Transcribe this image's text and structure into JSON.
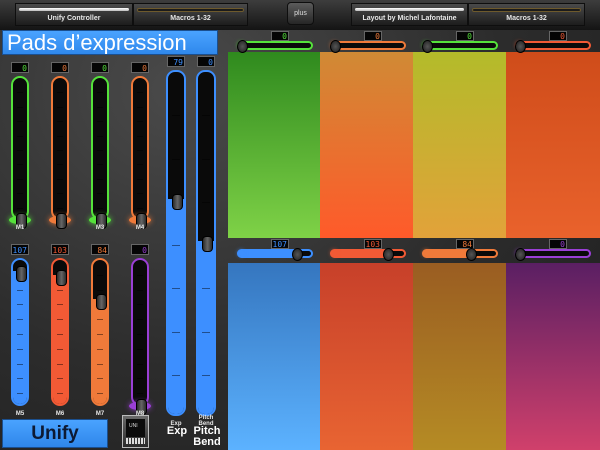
{
  "tabs": [
    {
      "label": "Unify Controller",
      "active": true
    },
    {
      "label": "Macros 1-32",
      "active": false
    },
    {
      "label": "Layout by Michel Lafontaine",
      "active": true
    },
    {
      "label": "Macros 1-32",
      "active": false
    }
  ],
  "plus_label": "plus",
  "title": "Pads d’expression",
  "top_row_faders": [
    {
      "label": "M1",
      "value": "0",
      "color": "#55e23b"
    },
    {
      "label": "",
      "value": "0",
      "color": "#f07a3a"
    },
    {
      "label": "M3",
      "value": "0",
      "color": "#55e23b"
    },
    {
      "label": "M4",
      "value": "0",
      "color": "#f07a3a"
    }
  ],
  "bottom_row_faders": [
    {
      "label": "M5",
      "value": "107",
      "color": "#3d8fff"
    },
    {
      "label": "M6",
      "value": "103",
      "color": "#f25a35"
    },
    {
      "label": "M7",
      "value": "84",
      "color": "#f07a3a"
    },
    {
      "label": "M8",
      "value": "0",
      "color": "#9a3fd6"
    }
  ],
  "expression": {
    "label": "Exp",
    "value": "79"
  },
  "pitch_bend": {
    "label": "Pitch Bend",
    "value": "0"
  },
  "pad_faders_top": [
    {
      "value": "0",
      "color": "#55e23b"
    },
    {
      "value": "0",
      "color": "#f07a3a"
    },
    {
      "value": "0",
      "color": "#55e23b"
    },
    {
      "value": "0",
      "color": "#f25a35"
    }
  ],
  "pad_faders_bottom": [
    {
      "value": "107",
      "color": "#3d8fff"
    },
    {
      "value": "103",
      "color": "#f25a35"
    },
    {
      "value": "84",
      "color": "#f07a3a"
    },
    {
      "value": "0",
      "color": "#9a3fd6"
    }
  ],
  "pads": [
    {
      "name": "pad-green",
      "colors": [
        "#2f8a1e",
        "#7fd247"
      ]
    },
    {
      "name": "pad-orange",
      "colors": [
        "#d08a35",
        "#ff5a2a"
      ]
    },
    {
      "name": "pad-yellow",
      "colors": [
        "#b3bb2a",
        "#e2a23a"
      ]
    },
    {
      "name": "pad-red",
      "colors": [
        "#cf4c1a",
        "#e9622c"
      ]
    },
    {
      "name": "pad-blue",
      "colors": [
        "#3576bf",
        "#5cb2ff"
      ]
    },
    {
      "name": "pad-red-2",
      "colors": [
        "#c7402a",
        "#e86432"
      ]
    },
    {
      "name": "pad-olive",
      "colors": [
        "#9a5d22",
        "#b58b24"
      ]
    },
    {
      "name": "pad-purple",
      "colors": [
        "#5a1f63",
        "#d0406b"
      ]
    }
  ],
  "unify_button": "Unify",
  "device_icon_label": "UNI",
  "icon": "device-thumbnail-icon"
}
